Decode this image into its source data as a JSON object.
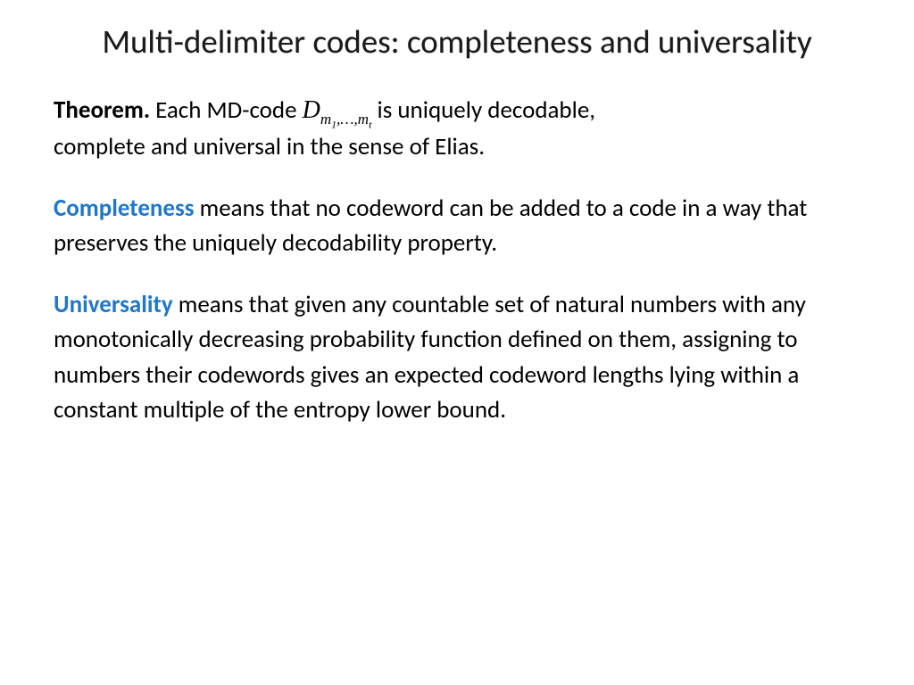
{
  "title": "Multi-delimiter codes: completeness and universality",
  "theorem": {
    "label": "Theorem.",
    "pre": " Each MD-code ",
    "math_D": "D",
    "math_sub": "m₁,…,m_t",
    "sub_m": "m",
    "sub_1": "1",
    "sub_sep": ",…,",
    "sub_m2": "m",
    "sub_t": "t",
    "post1": " is uniquely decodable,",
    "post2": "complete and universal in the sense of Elias."
  },
  "completeness": {
    "keyword": "Completeness",
    "text": " means that no codeword can be added to a code in a way that preserves the uniquely decodability property."
  },
  "universality": {
    "keyword": "Universality",
    "text": " means that given any countable set of natural numbers with any monotonically decreasing probability function defined on them, assigning to numbers their codewords  gives an expected codeword lengths lying within a constant multiple of the entropy lower bound."
  }
}
